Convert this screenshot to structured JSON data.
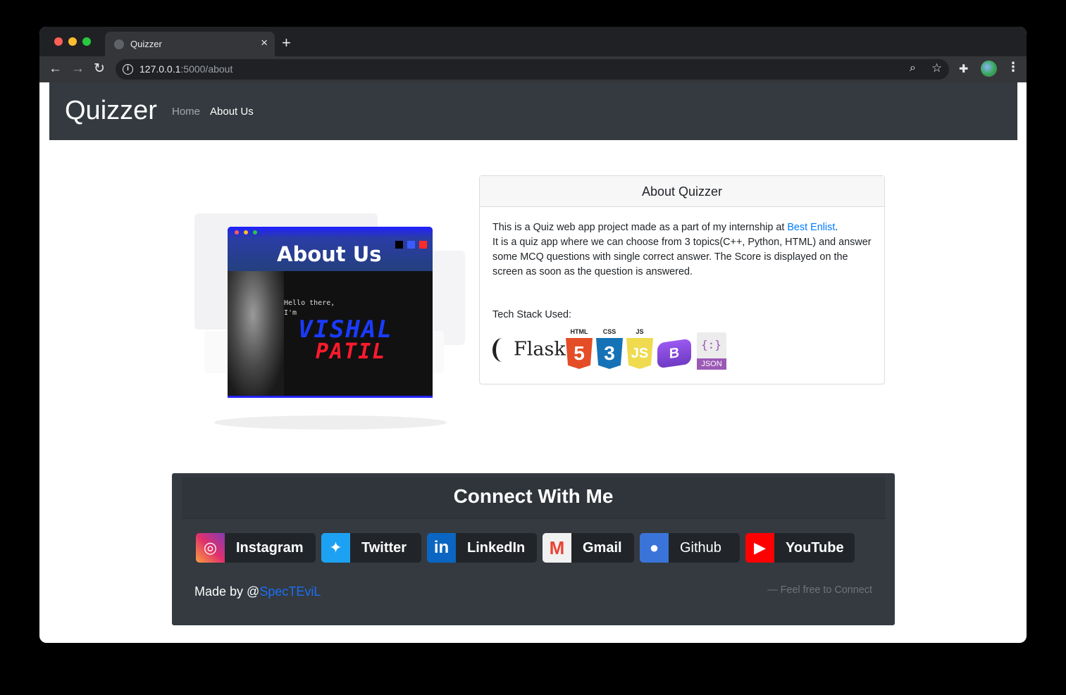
{
  "browser": {
    "tab_title": "Quizzer",
    "url_host": "127.0.0.1",
    "url_path": ":5000/about"
  },
  "navbar": {
    "brand": "Quizzer",
    "links": [
      {
        "label": "Home",
        "active": false
      },
      {
        "label": "About Us",
        "active": true
      }
    ]
  },
  "hero": {
    "title": "About Us",
    "greeting_1": "Hello there,",
    "greeting_2": "I'm",
    "name_first": "VISHAL",
    "name_last": "PATIL"
  },
  "about_card": {
    "header": "About Quizzer",
    "intro_prefix": "This is a Quiz web app project made as a part of my internship at ",
    "intro_link": "Best Enlist",
    "intro_suffix": ".",
    "description": "It is a quiz app where we can choose from 3 topics(C++, Python, HTML) and answer some MCQ questions with single correct answer. The Score is displayed on the screen as soon as the question is answered.",
    "tech_label": "Tech Stack Used:",
    "tech_stack": [
      {
        "name": "Flask",
        "icon": "flask-icon"
      },
      {
        "name": "HTML",
        "badge": "5",
        "color": "#e44d26",
        "icon": "html5-icon"
      },
      {
        "name": "CSS",
        "badge": "3",
        "color": "#1572b6",
        "icon": "css3-icon"
      },
      {
        "name": "JS",
        "badge": "JS",
        "color": "#f0db4f",
        "icon": "javascript-icon"
      },
      {
        "name": "Bootstrap",
        "badge": "B",
        "color": "#7952b3",
        "icon": "bootstrap-icon"
      },
      {
        "name": "JSON",
        "badge": "{:}",
        "color": "#9b59b6",
        "icon": "json-icon"
      }
    ]
  },
  "connect": {
    "title": "Connect With Me",
    "socials": [
      {
        "label": "Instagram",
        "icon": "instagram-icon"
      },
      {
        "label": "Twitter",
        "icon": "twitter-icon"
      },
      {
        "label": "LinkedIn",
        "icon": "linkedin-icon"
      },
      {
        "label": "Gmail",
        "icon": "gmail-icon"
      },
      {
        "label": "Github",
        "icon": "github-icon"
      },
      {
        "label": "YouTube",
        "icon": "youtube-icon"
      }
    ],
    "made_by_prefix": "Made by @",
    "made_by_handle": "SpecTEviL",
    "tagline": "— Feel free to Connect"
  },
  "colors": {
    "navbar_bg": "#343a40",
    "link": "#007bff",
    "brand_blue": "#1d6ff2"
  }
}
